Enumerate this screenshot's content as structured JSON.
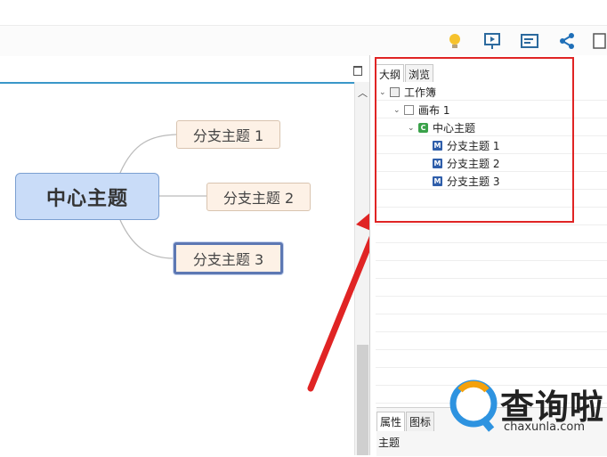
{
  "toolbar": {
    "icons": [
      "lightbulb-icon",
      "presentation-icon",
      "panel-icon",
      "share-icon",
      "export-icon"
    ]
  },
  "mindmap": {
    "central": "中心主题",
    "branches": [
      "分支主题 1",
      "分支主题 2",
      "分支主题 3"
    ]
  },
  "right_panel": {
    "tabs": [
      "大纲",
      "浏览"
    ],
    "outline": {
      "workbook": "工作簿",
      "sheet": "画布 1",
      "central": "中心主题",
      "topics": [
        "分支主题 1",
        "分支主题 2",
        "分支主题 3"
      ],
      "icon_letters": {
        "central": "C",
        "topic": "M"
      }
    }
  },
  "bottom_panel": {
    "tabs": [
      "属性",
      "图标"
    ],
    "property_label": "主题"
  },
  "watermark": {
    "name": "查询啦",
    "url": "chaxunla.com"
  },
  "colors": {
    "accent": "#3a97c9",
    "central_fill": "#c9dcf8",
    "branch_fill": "#fdf1e6",
    "highlight": "#e02424"
  }
}
